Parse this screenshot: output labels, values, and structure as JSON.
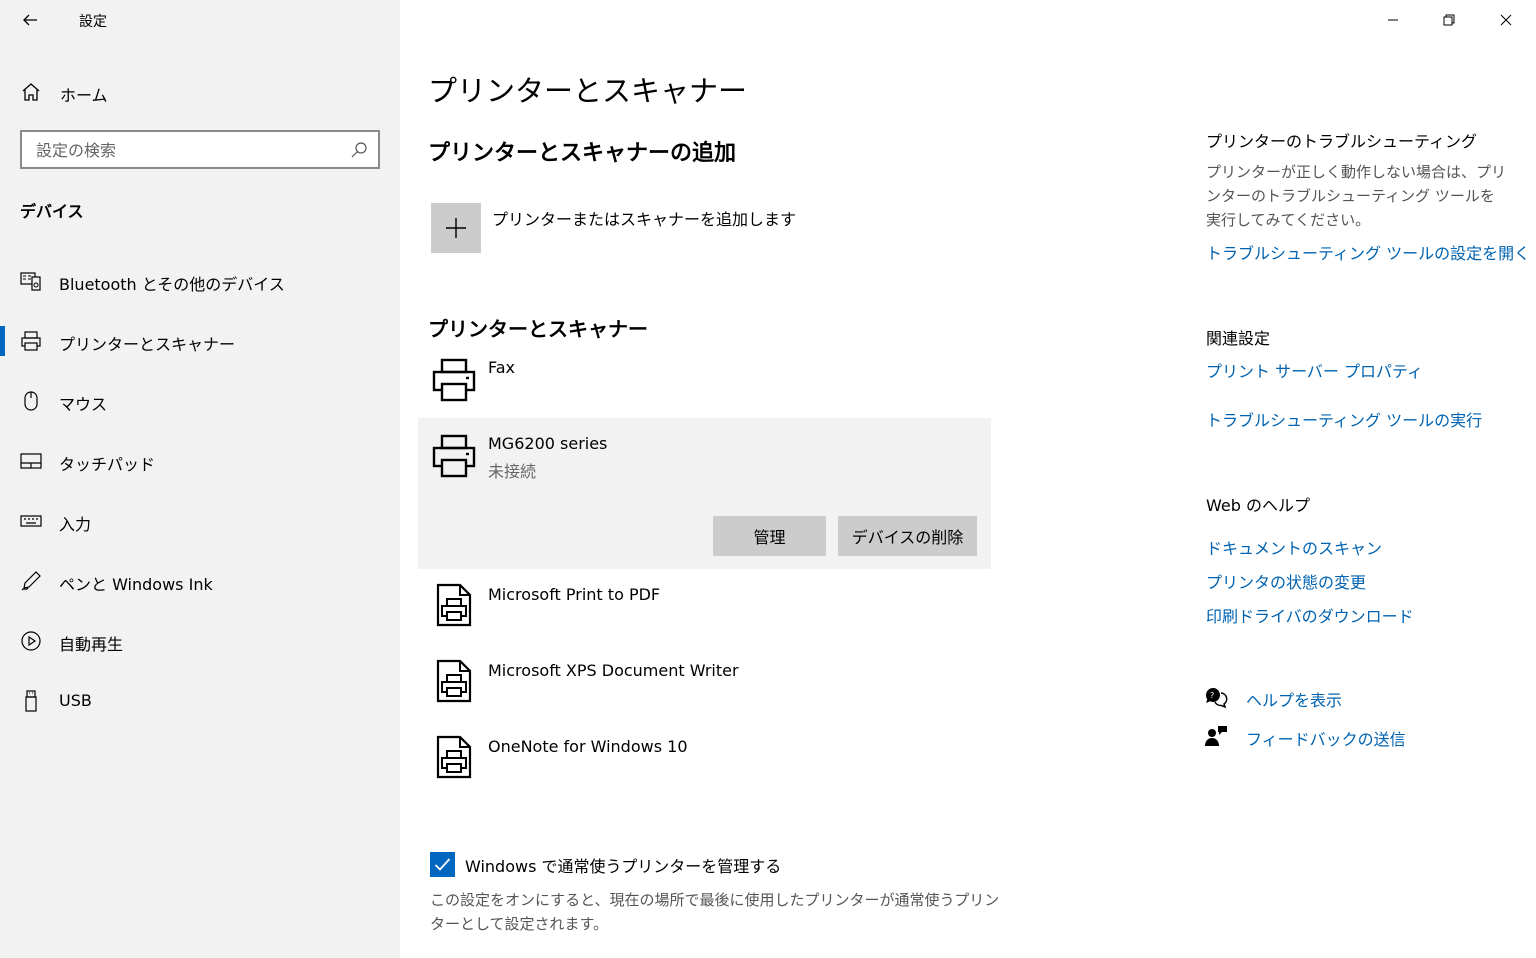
{
  "window": {
    "title": "設定",
    "controls": [
      "minimize",
      "restore",
      "close"
    ]
  },
  "sidebar": {
    "home_label": "ホーム",
    "search_placeholder": "設定の検索",
    "section_title": "デバイス",
    "items": [
      {
        "label": "Bluetooth とその他のデバイス",
        "icon": "bluetooth-devices-icon",
        "active": false
      },
      {
        "label": "プリンターとスキャナー",
        "icon": "printer-icon",
        "active": true
      },
      {
        "label": "マウス",
        "icon": "mouse-icon",
        "active": false
      },
      {
        "label": "タッチパッド",
        "icon": "touchpad-icon",
        "active": false
      },
      {
        "label": "入力",
        "icon": "keyboard-icon",
        "active": false
      },
      {
        "label": "ペンと Windows Ink",
        "icon": "pen-icon",
        "active": false
      },
      {
        "label": "自動再生",
        "icon": "autoplay-icon",
        "active": false
      },
      {
        "label": "USB",
        "icon": "usb-icon",
        "active": false
      }
    ]
  },
  "main": {
    "title": "プリンターとスキャナー",
    "add_section_title": "プリンターとスキャナーの追加",
    "add_label": "プリンターまたはスキャナーを追加します",
    "list_title": "プリンターとスキャナー",
    "devices": [
      {
        "name": "Fax",
        "status": "",
        "icon": "printer-icon"
      },
      {
        "name": "MG6200 series",
        "status": "未接続",
        "icon": "printer-icon",
        "selected": true
      },
      {
        "name": "Microsoft Print to PDF",
        "status": "",
        "icon": "document-printer-icon"
      },
      {
        "name": "Microsoft XPS Document Writer",
        "status": "",
        "icon": "document-printer-icon"
      },
      {
        "name": "OneNote for Windows 10",
        "status": "",
        "icon": "document-printer-icon"
      }
    ],
    "manage_button": "管理",
    "remove_button": "デバイスの削除",
    "checkbox_label": "Windows で通常使うプリンターを管理する",
    "checkbox_checked": true,
    "checkbox_note": "この設定をオンにすると、現在の場所で最後に使用したプリンターが通常使うプリンターとして設定されます。"
  },
  "right_panel": {
    "troubleshoot_heading": "プリンターのトラブルシューティング",
    "troubleshoot_text": "プリンターが正しく動作しない場合は、プリンターのトラブルシューティング ツールを実行してみてください。",
    "troubleshoot_link": "トラブルシューティング ツールの設定を開く",
    "related_heading": "関連設定",
    "related_links": [
      "プリント サーバー プロパティ",
      "トラブルシューティング ツールの実行"
    ],
    "web_help_heading": "Web のヘルプ",
    "web_help_links": [
      "ドキュメントのスキャン",
      "プリンタの状態の変更",
      "印刷ドライバのダウンロード"
    ],
    "help_link": "ヘルプを表示",
    "feedback_link": "フィードバックの送信"
  },
  "colors": {
    "accent": "#0067c0",
    "link": "#0063b1",
    "sidebar_bg": "#f2f2f2"
  }
}
